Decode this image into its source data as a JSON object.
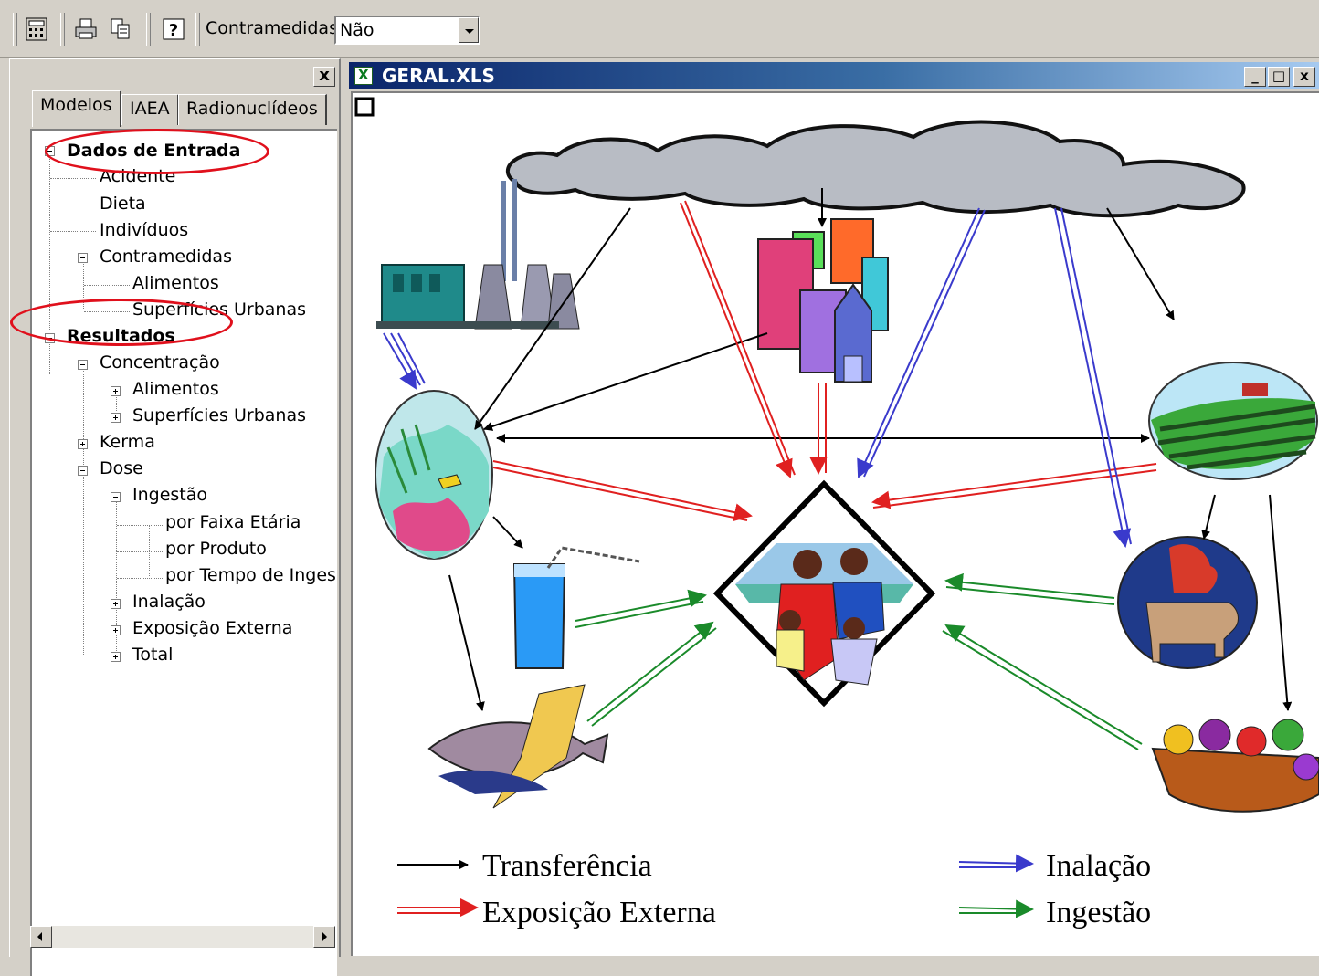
{
  "toolbar": {
    "buttons": [
      {
        "icon": "calculator-icon"
      },
      {
        "icon": "print-icon"
      },
      {
        "icon": "copy-icon"
      },
      {
        "icon": "help-icon"
      }
    ],
    "countermeasures_label": "Contramedidas",
    "countermeasures_value": "Não"
  },
  "left_panel": {
    "close_label": "x",
    "tabs": [
      "Modelos",
      "IAEA",
      "Radionuclídeos"
    ],
    "active_tab": "Modelos",
    "tree": {
      "dados": "Dados de Entrada",
      "acidente": "Acidente",
      "dieta": "Dieta",
      "individuos": "Indivíduos",
      "contramedidas": "Contramedidas",
      "alimentos1": "Alimentos",
      "superficies1": "Superfícies Urbanas",
      "resultados": "Resultados",
      "concentracao": "Concentração",
      "alimentos2": "Alimentos",
      "superficies2": "Superfícies Urbanas",
      "kerma": "Kerma",
      "dose": "Dose",
      "ingestao": "Ingestão",
      "faixa": "por Faixa Etária",
      "produto": "por Produto",
      "tempo": "por Tempo de Inges",
      "inalacao": "Inalação",
      "exposicao": "Exposição Externa",
      "total": "Total"
    },
    "highlight_color": "#e0101c"
  },
  "window": {
    "title": "GERAL.XLS",
    "minimize": "_",
    "maximize": "□",
    "close": "x"
  },
  "diagram": {
    "nodes": [
      "cloud",
      "power-plant",
      "city-buildings",
      "sea-ecosystem",
      "farm-field",
      "people-group",
      "water-glass",
      "livestock",
      "fish",
      "fruit-basket"
    ],
    "legend": {
      "transfer": "Transferência",
      "external": "Exposição Externa",
      "inhalation": "Inalação",
      "ingestion": "Ingestão"
    },
    "colors": {
      "transfer": "#000000",
      "external": "#e02020",
      "inhalation": "#3a3acc",
      "ingestion": "#1a8a2a"
    }
  }
}
